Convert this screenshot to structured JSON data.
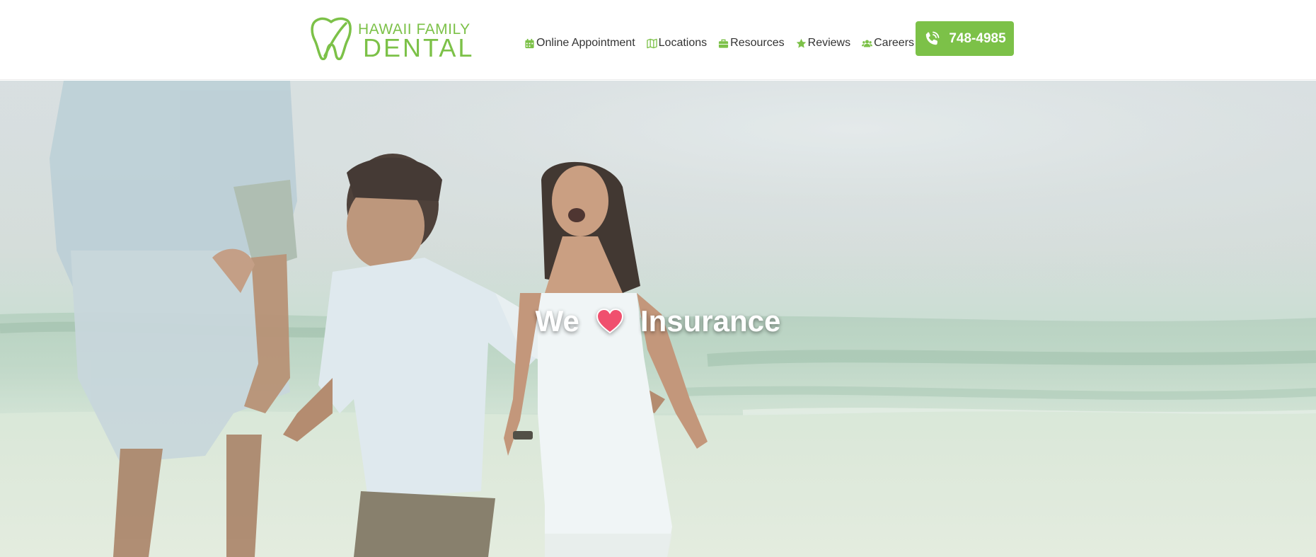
{
  "header": {
    "logo": {
      "line1": "HAWAII FAMILY",
      "line2": "DENTAL",
      "icon": "tooth-icon"
    },
    "nav": [
      {
        "label": "Online Appointment",
        "icon": "calendar-icon"
      },
      {
        "label": "Locations",
        "icon": "map-icon"
      },
      {
        "label": "Resources",
        "icon": "briefcase-icon"
      },
      {
        "label": "Reviews",
        "icon": "star-icon"
      },
      {
        "label": "Careers",
        "icon": "users-icon"
      }
    ],
    "phone": {
      "label": "748-4985",
      "icon": "phone-icon"
    }
  },
  "hero": {
    "word_before": "We",
    "heart_icon": "heart-icon",
    "word_after": "Insurance"
  },
  "colors": {
    "brand_green": "#7cc148",
    "nav_text": "#333333",
    "heart": "#f0506e"
  }
}
